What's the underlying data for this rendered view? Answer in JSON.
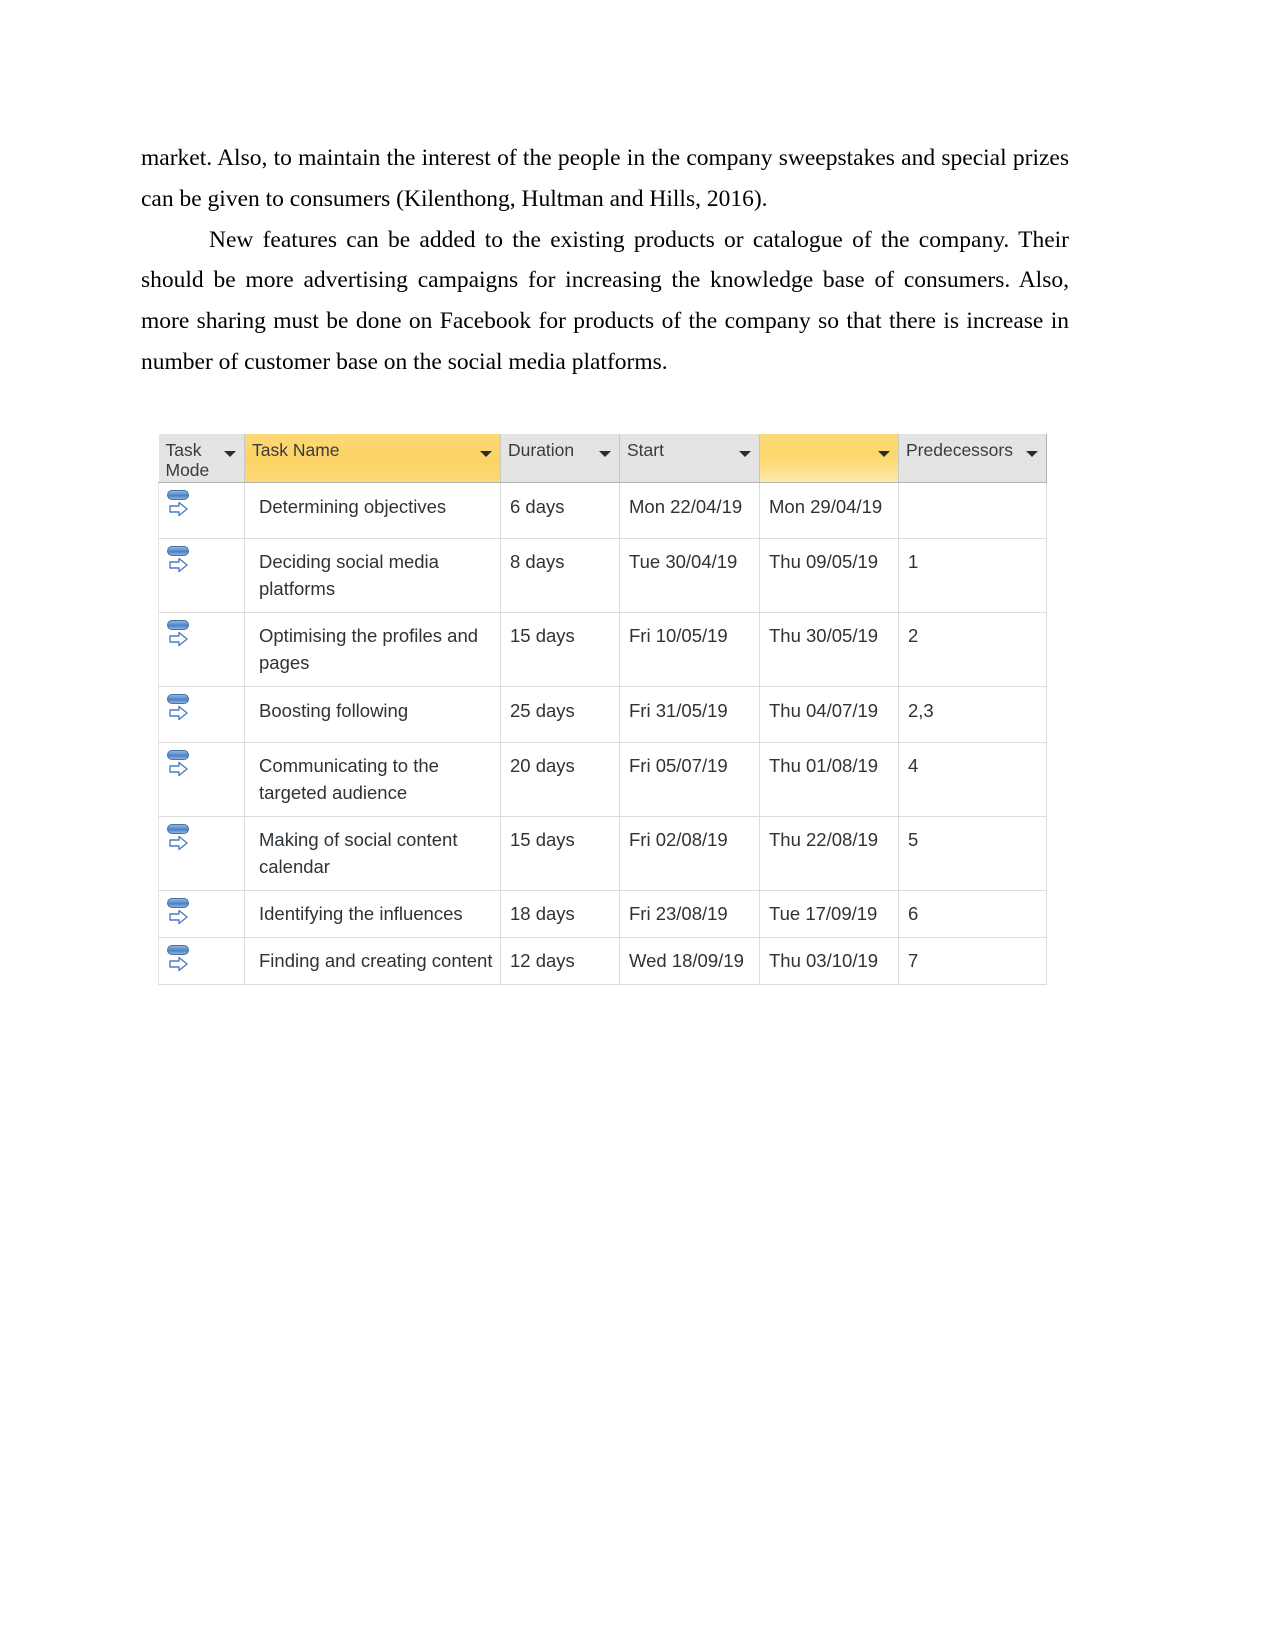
{
  "document": {
    "paragraphs": [
      "market. Also, to maintain the interest of the people in the company sweepstakes and special prizes can be given to consumers (Kilenthong,  Hultman and Hills,  2016).",
      "New features can be added to the existing products or catalogue of the company. Their should be more advertising campaigns for increasing the knowledge base of consumers. Also, more sharing must be done on Facebook for products of the company so that there is increase in number of customer base on the social media platforms."
    ]
  },
  "project_table": {
    "columns": [
      {
        "key": "task_mode",
        "label": "Task Mode",
        "highlight": false,
        "has_filter": true
      },
      {
        "key": "task_name",
        "label": "Task Name",
        "highlight": true,
        "has_filter": true
      },
      {
        "key": "duration",
        "label": "Duration",
        "highlight": false,
        "has_filter": true
      },
      {
        "key": "start",
        "label": "Start",
        "highlight": false,
        "has_filter": true
      },
      {
        "key": "finish",
        "label": "",
        "highlight": true,
        "has_filter": true
      },
      {
        "key": "predecessors",
        "label": "Predecessors",
        "highlight": false,
        "has_filter": true
      }
    ],
    "colors": {
      "header_background": "#e4e4e4",
      "header_highlight": "#fcd566",
      "grid_line": "#dcdcdc",
      "task_mode_icon": "#5b8fd0",
      "text": "#2e3338"
    },
    "rows": [
      {
        "task_mode": "auto-scheduled",
        "task_name": "Determining objectives",
        "duration": "6 days",
        "start": "Mon 22/04/19",
        "finish": "Mon 29/04/19",
        "predecessors": ""
      },
      {
        "task_mode": "auto-scheduled",
        "task_name": "Deciding social media platforms",
        "duration": "8 days",
        "start": "Tue 30/04/19",
        "finish": "Thu 09/05/19",
        "predecessors": "1"
      },
      {
        "task_mode": "auto-scheduled",
        "task_name": "Optimising the profiles and pages",
        "duration": "15 days",
        "start": "Fri 10/05/19",
        "finish": "Thu 30/05/19",
        "predecessors": "2"
      },
      {
        "task_mode": "auto-scheduled",
        "task_name": "Boosting following",
        "duration": "25 days",
        "start": "Fri 31/05/19",
        "finish": "Thu 04/07/19",
        "predecessors": "2,3"
      },
      {
        "task_mode": "auto-scheduled",
        "task_name": "Communicating to the targeted audience",
        "duration": "20 days",
        "start": "Fri 05/07/19",
        "finish": "Thu 01/08/19",
        "predecessors": "4"
      },
      {
        "task_mode": "auto-scheduled",
        "task_name": "Making of social content calendar",
        "duration": "15 days",
        "start": "Fri 02/08/19",
        "finish": "Thu 22/08/19",
        "predecessors": "5"
      },
      {
        "task_mode": "auto-scheduled",
        "task_name": "Identifying the influences",
        "duration": "18 days",
        "start": "Fri 23/08/19",
        "finish": "Tue 17/09/19",
        "predecessors": "6"
      },
      {
        "task_mode": "auto-scheduled",
        "task_name": "Finding and creating content",
        "duration": "12 days",
        "start": "Wed 18/09/19",
        "finish": "Thu 03/10/19",
        "predecessors": "7"
      }
    ]
  }
}
